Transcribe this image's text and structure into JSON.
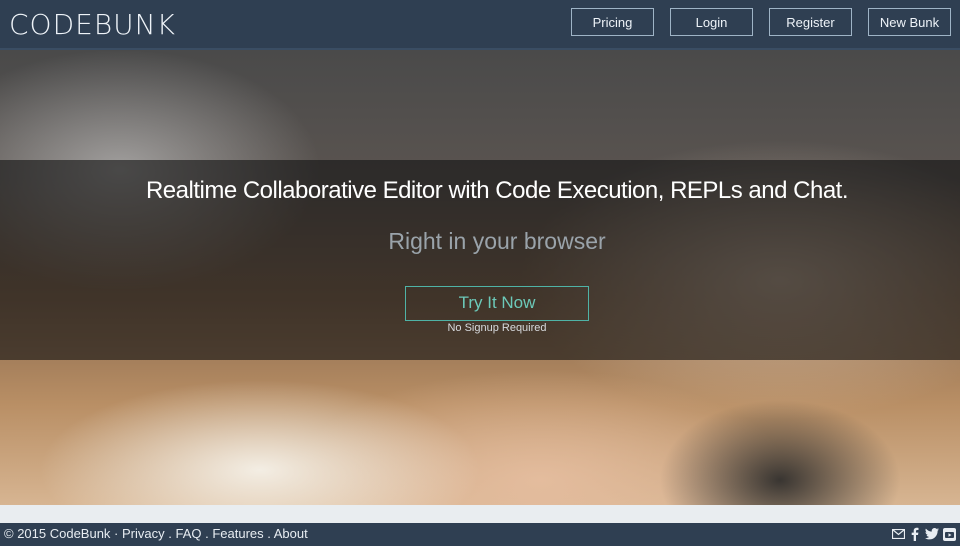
{
  "header": {
    "brand": "CODEBUNK",
    "nav": [
      {
        "label": "Pricing"
      },
      {
        "label": "Login"
      },
      {
        "label": "Register"
      },
      {
        "label": "New Bunk"
      }
    ]
  },
  "hero": {
    "headline": "Realtime Collaborative Editor with Code Execution, REPLs and Chat.",
    "subline": "Right in your browser",
    "cta_label": "Try It Now",
    "cta_note": "No Signup Required"
  },
  "footer": {
    "copyright": "© 2015 CodeBunk",
    "sep1": " · ",
    "links": [
      "Privacy",
      "FAQ",
      "Features",
      "About"
    ],
    "sep": " . ",
    "social": [
      "email-icon",
      "facebook-icon",
      "twitter-icon",
      "youtube-icon"
    ]
  }
}
